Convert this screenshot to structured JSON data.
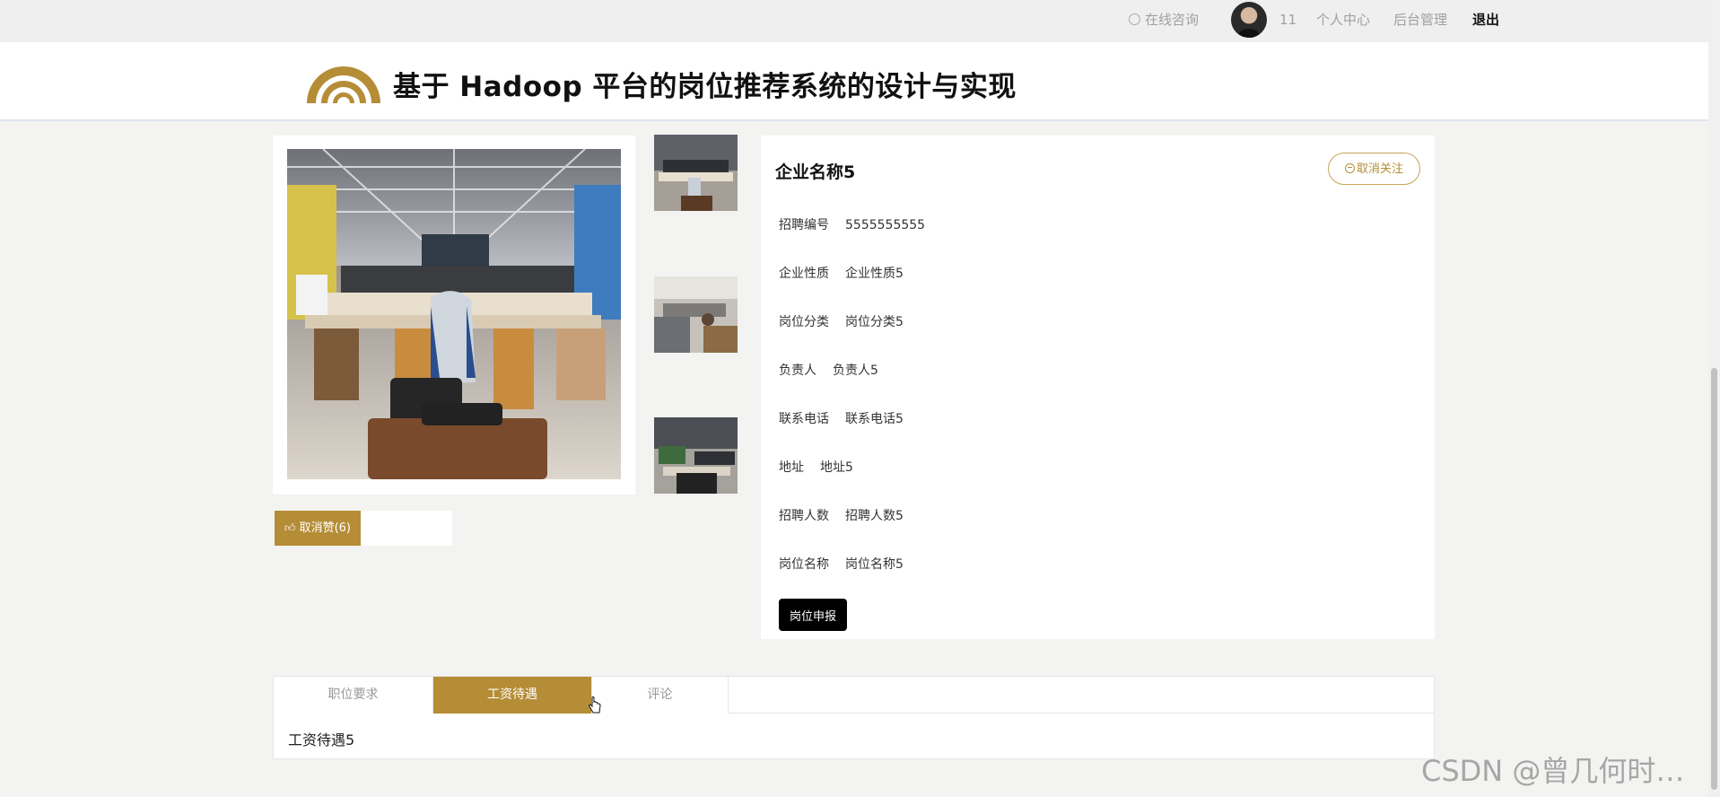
{
  "topbar": {
    "consult": "在线咨询",
    "username": "11",
    "personal_center": "个人中心",
    "admin": "后台管理",
    "logout": "退出"
  },
  "header": {
    "title": "基于 Hadoop 平台的岗位推荐系统的设计与实现"
  },
  "gallery": {
    "like_button": "取消赞(6)"
  },
  "job": {
    "company": "企业名称5",
    "unfollow_button": "取消关注",
    "fields": [
      {
        "label": "招聘编号",
        "value": "5555555555"
      },
      {
        "label": "企业性质",
        "value": "企业性质5"
      },
      {
        "label": "岗位分类",
        "value": "岗位分类5"
      },
      {
        "label": "负责人",
        "value": "负责人5"
      },
      {
        "label": "联系电话",
        "value": "联系电话5"
      },
      {
        "label": "地址",
        "value": "地址5"
      },
      {
        "label": "招聘人数",
        "value": "招聘人数5"
      },
      {
        "label": "岗位名称",
        "value": "岗位名称5"
      }
    ],
    "apply_button": "岗位申报"
  },
  "tabs": {
    "items": [
      "职位要求",
      "工资待遇",
      "评论"
    ],
    "active": "工资待遇",
    "content": "工资待遇5"
  },
  "watermark": "CSDN @曾几何时…",
  "colors": {
    "accent": "#b58d37",
    "page_bg": "#f3f3f1",
    "topbar_bg": "#efefef"
  }
}
